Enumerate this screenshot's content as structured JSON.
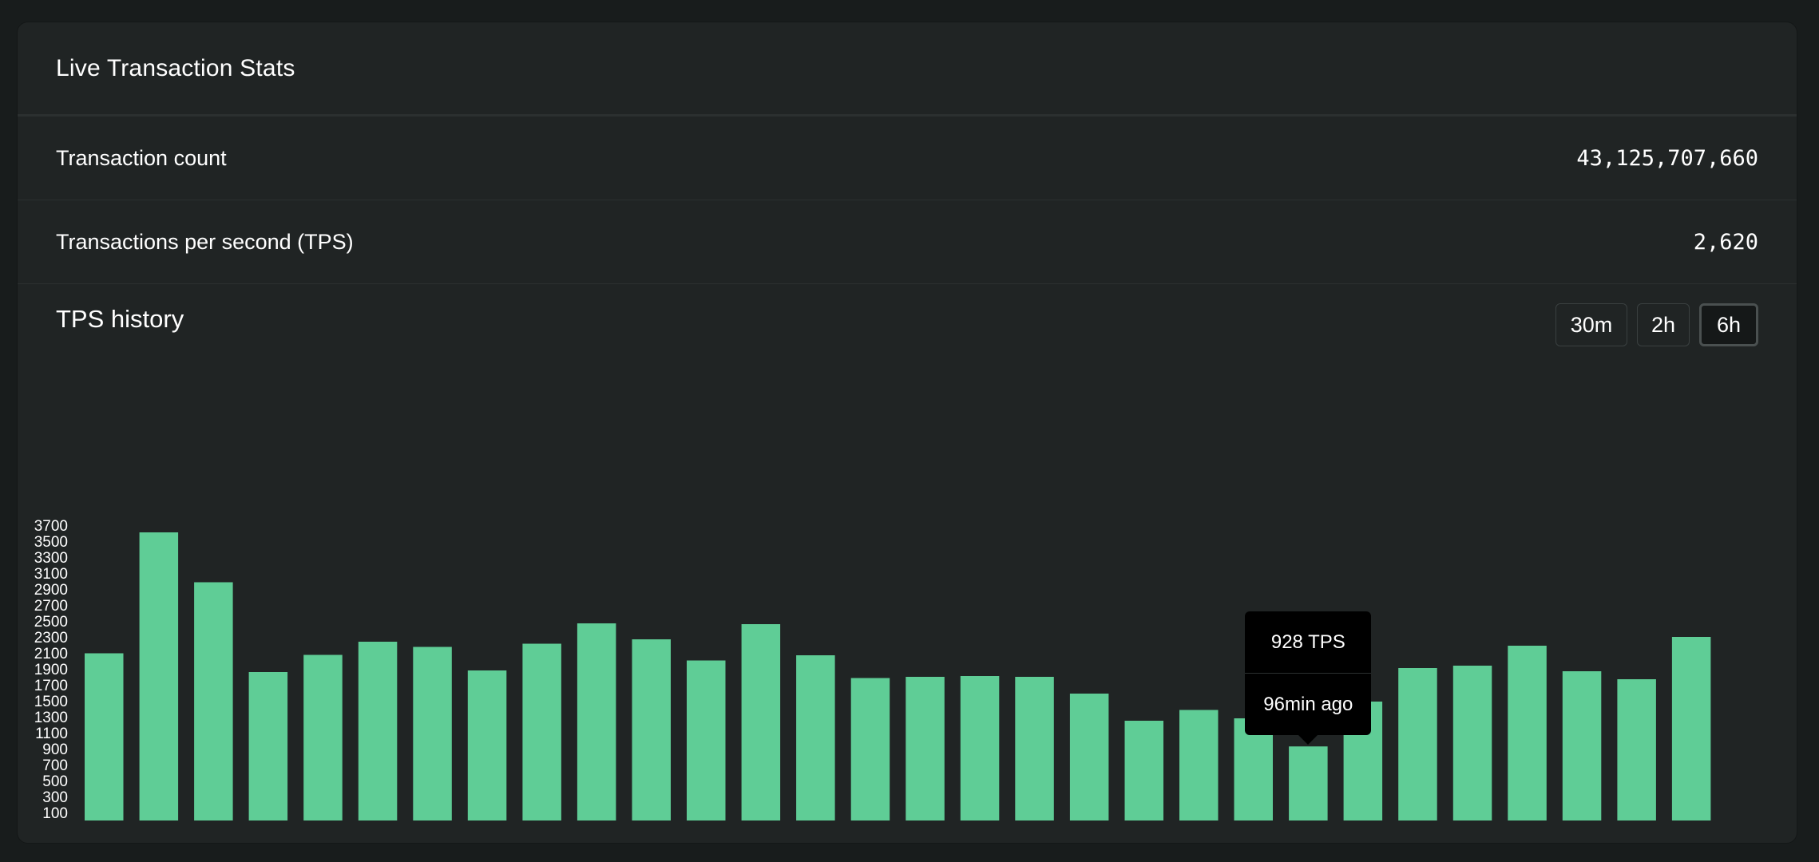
{
  "card": {
    "title": "Live Transaction Stats"
  },
  "stats": {
    "transaction_count_label": "Transaction count",
    "transaction_count_value": "43,125,707,660",
    "tps_label": "Transactions per second (TPS)",
    "tps_value": "2,620"
  },
  "history": {
    "title": "TPS history",
    "ranges": [
      "30m",
      "2h",
      "6h"
    ],
    "active_range": "6h"
  },
  "tooltip": {
    "value": "928 TPS",
    "time": "96min ago"
  },
  "colors": {
    "bar": "#5fcd96",
    "background": "#202424",
    "tick_text": "#ffffff"
  },
  "chart_data": {
    "type": "bar",
    "title": "",
    "xlabel": "",
    "ylabel": "",
    "ylim": [
      0,
      3700
    ],
    "yticks": [
      100,
      300,
      500,
      700,
      900,
      1100,
      1300,
      1500,
      1700,
      1900,
      2100,
      2300,
      2500,
      2700,
      2900,
      3100,
      3300,
      3500,
      3700
    ],
    "values": [
      2095,
      3610,
      2985,
      1860,
      2075,
      2240,
      2175,
      1880,
      2215,
      2470,
      2270,
      2005,
      2460,
      2070,
      1785,
      1800,
      1810,
      1800,
      1590,
      1250,
      1385,
      1280,
      928,
      1490,
      1910,
      1940,
      2190,
      1870,
      1770,
      2300
    ],
    "highlight_index": 22,
    "grid": false,
    "legend": "none"
  }
}
